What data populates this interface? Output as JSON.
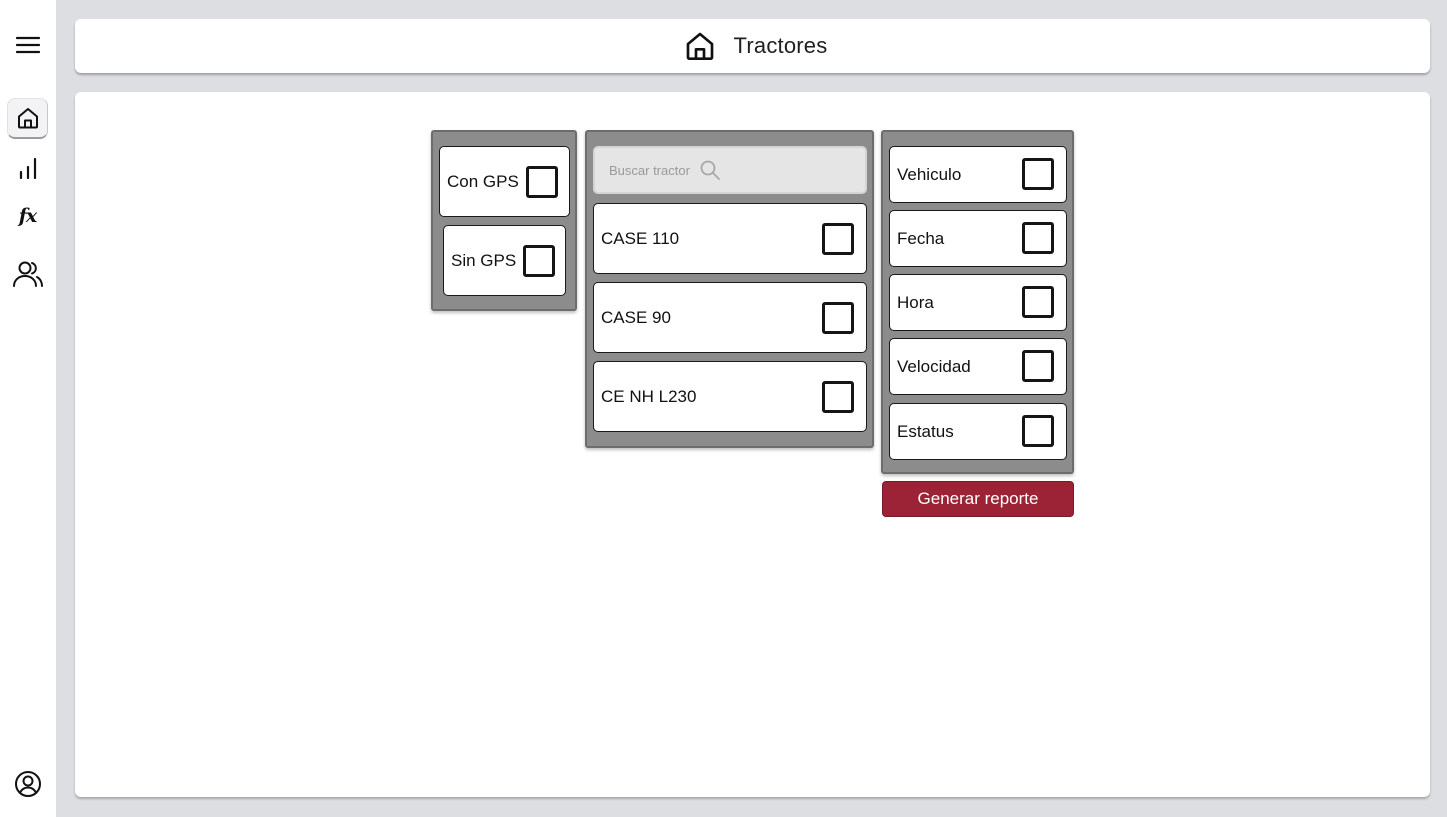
{
  "header": {
    "title": "Tractores",
    "icon": "home-icon"
  },
  "sidebar": {
    "items": [
      {
        "name": "menu",
        "icon": "hamburger-menu-icon"
      },
      {
        "name": "home",
        "icon": "home-icon",
        "active": true
      },
      {
        "name": "stats",
        "icon": "bar-chart-icon"
      },
      {
        "name": "formulas",
        "icon": "fx-icon",
        "glyph": "fx"
      },
      {
        "name": "users",
        "icon": "users-icon"
      },
      {
        "name": "profile",
        "icon": "user-circle-icon"
      }
    ]
  },
  "gps_filter": {
    "items": [
      {
        "label": "Con GPS",
        "checked": false
      },
      {
        "label": "Sin GPS",
        "checked": false
      }
    ]
  },
  "tractors": {
    "search_placeholder": "Buscar tractor",
    "items": [
      {
        "label": "CASE 110",
        "checked": false
      },
      {
        "label": "CASE 90",
        "checked": false
      },
      {
        "label": "CE NH L230",
        "checked": false
      }
    ]
  },
  "fields": {
    "items": [
      {
        "label": "Vehiculo",
        "checked": false
      },
      {
        "label": "Fecha",
        "checked": false
      },
      {
        "label": "Hora",
        "checked": false
      },
      {
        "label": "Velocidad",
        "checked": false
      },
      {
        "label": "Estatus",
        "checked": false
      }
    ]
  },
  "report_button": {
    "label": "Generar reporte"
  },
  "colors": {
    "accent": "#9b2335",
    "panel": "#8c8c8c",
    "background": "#dddee2"
  }
}
